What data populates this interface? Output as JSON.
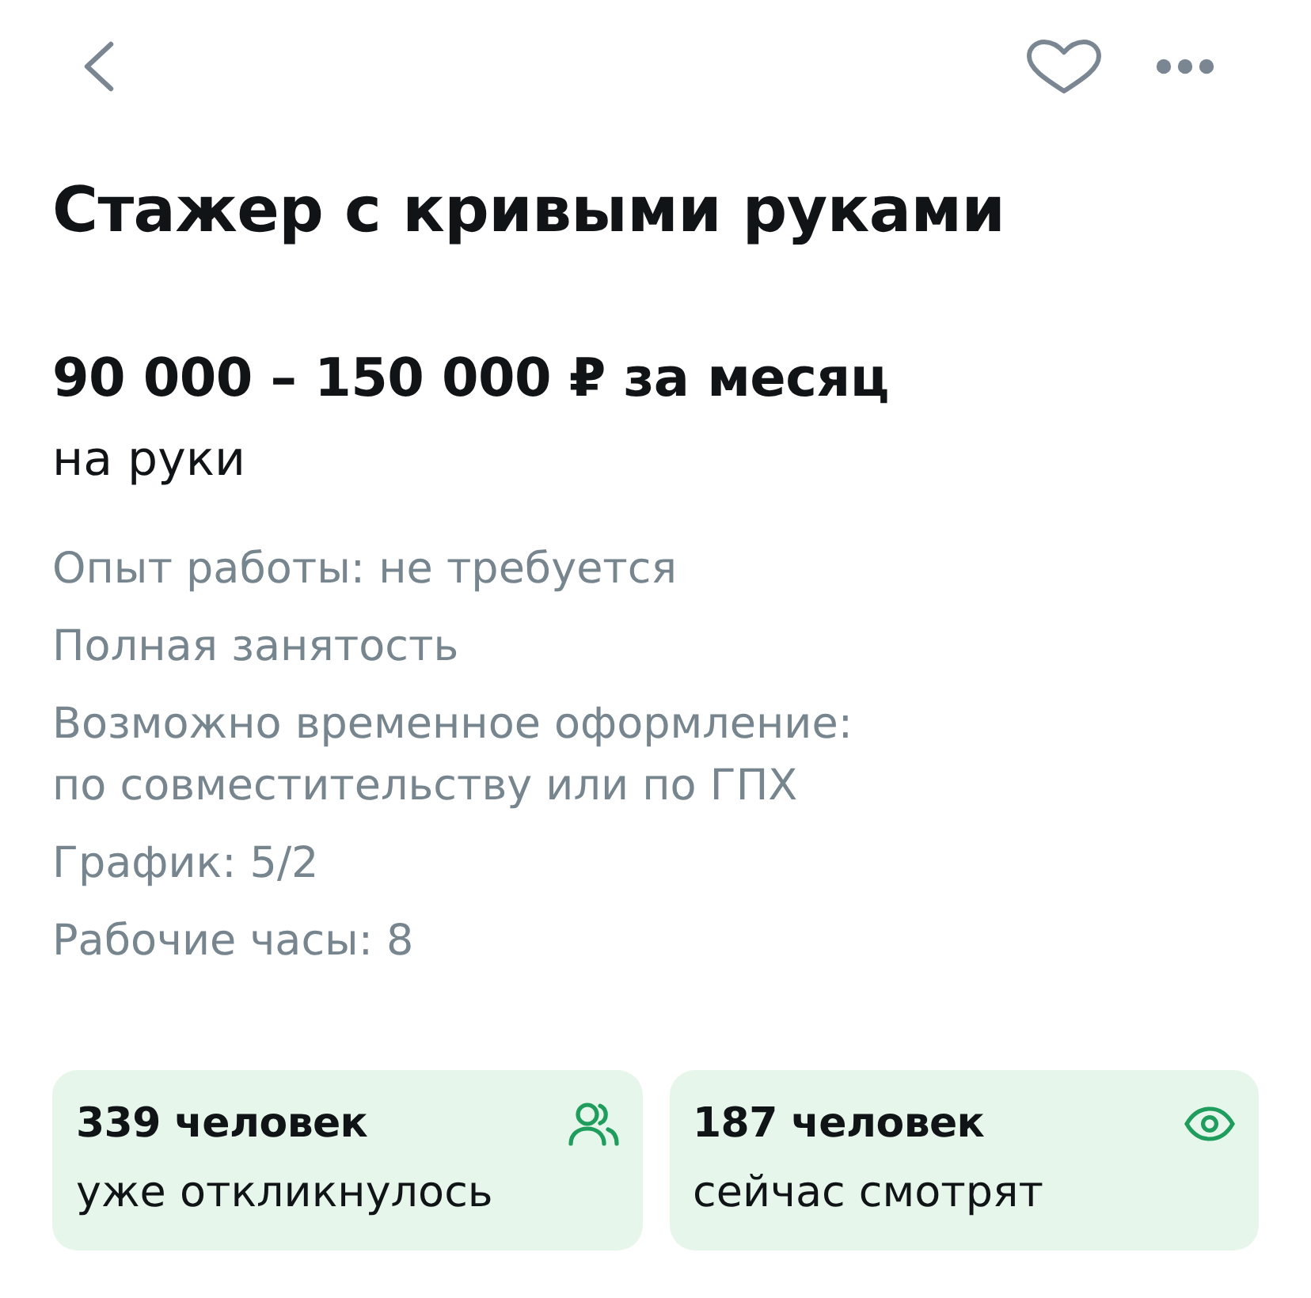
{
  "header": {
    "favorite": false
  },
  "vacancy": {
    "title": "Стажер с кривыми руками",
    "salary": "90 000 – 150 000 ₽ за месяц",
    "salary_note": "на руки",
    "details": [
      "Опыт работы: не требуется",
      "Полная занятость",
      "Возможно временное оформление: по совместительству или по ГПХ",
      "График: 5/2",
      "Рабочие часы: 8"
    ]
  },
  "stats": [
    {
      "kind": "responded",
      "count": "339 человек",
      "caption": "уже откликнулось"
    },
    {
      "kind": "viewing",
      "count": "187 человек",
      "caption": "сейчас смотрят"
    }
  ]
}
